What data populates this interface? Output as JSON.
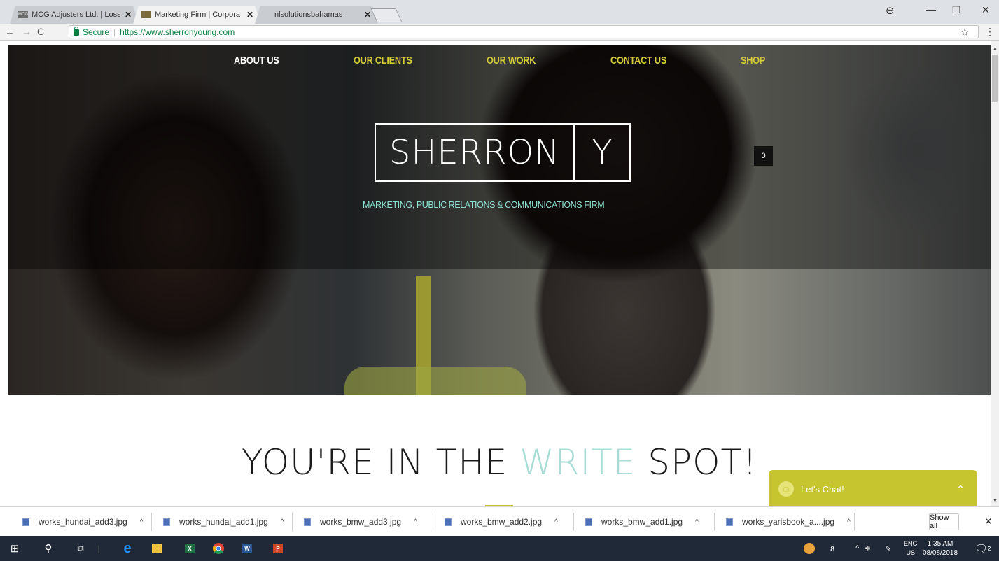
{
  "browser": {
    "tabs": [
      {
        "title": "MCG Adjusters Ltd. | Loss",
        "favicon": "MCG",
        "active": false
      },
      {
        "title": "Marketing Firm | Corpora",
        "favicon": "",
        "active": true
      },
      {
        "title": "nlsolutionsbahamas",
        "favicon": "",
        "active": false
      }
    ],
    "secure_label": "Secure",
    "url": "https://www.sherronyoung.com"
  },
  "site": {
    "nav": [
      {
        "label": "ABOUT US",
        "color": "#ffffff"
      },
      {
        "label": "OUR CLIENTS",
        "color": "#d6cc3b"
      },
      {
        "label": "OUR WORK",
        "color": "#d6cc3b"
      },
      {
        "label": "CONTACT US",
        "color": "#d6cc3b"
      },
      {
        "label": "SHOP",
        "color": "#d6cc3b"
      }
    ],
    "logo_left": "SHERRON",
    "logo_right": "Y",
    "tagline": "MARKETING, PUBLIC RELATIONS & COMMUNICATIONS  FIRM",
    "cart_count": "0",
    "headline_pre": "YOU'RE IN THE ",
    "headline_accent": "WRITE",
    "headline_post": " SPOT!",
    "chat_label": "Let's Chat!"
  },
  "downloads": {
    "items": [
      "works_hundai_add3.jpg",
      "works_hundai_add1.jpg",
      "works_bmw_add3.jpg",
      "works_bmw_add2.jpg",
      "works_bmw_add1.jpg",
      "works_yarisbook_a....jpg"
    ],
    "show_all": "Show all"
  },
  "taskbar": {
    "lang_top": "ENG",
    "lang_bottom": "US",
    "time": "1:35 AM",
    "date": "08/08/2018",
    "notifications": "2"
  },
  "colors": {
    "accent_yellow": "#c6c52f",
    "nav_yellow": "#d6cc3b",
    "tagline_teal": "#8fe3d4",
    "headline_accent": "#a8ddd6"
  }
}
